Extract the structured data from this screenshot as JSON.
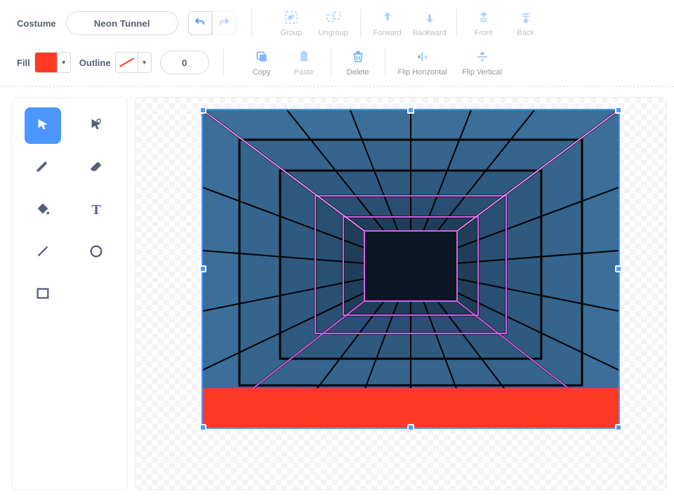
{
  "header": {
    "costume_label": "Costume",
    "costume_name": "Neon Tunnel",
    "actions": {
      "group": "Group",
      "ungroup": "Ungroup",
      "forward": "Forward",
      "backward": "Backward",
      "front": "Front",
      "back": "Back"
    }
  },
  "row2": {
    "fill_label": "Fill",
    "fill_color": "#FF3A24",
    "outline_label": "Outline",
    "outline_width": "0",
    "actions": {
      "copy": "Copy",
      "paste": "Paste",
      "delete": "Delete",
      "flip_h": "Flip Horizontal",
      "flip_v": "Flip Vertical"
    }
  },
  "tools": {
    "select": "select",
    "reshape": "reshape",
    "brush": "brush",
    "eraser": "eraser",
    "fill": "fill",
    "text": "text",
    "line": "line",
    "circle": "circle",
    "rect": "rectangle"
  },
  "canvas": {
    "drawing_name": "Neon Tunnel",
    "accent_color": "#FF3A24"
  }
}
